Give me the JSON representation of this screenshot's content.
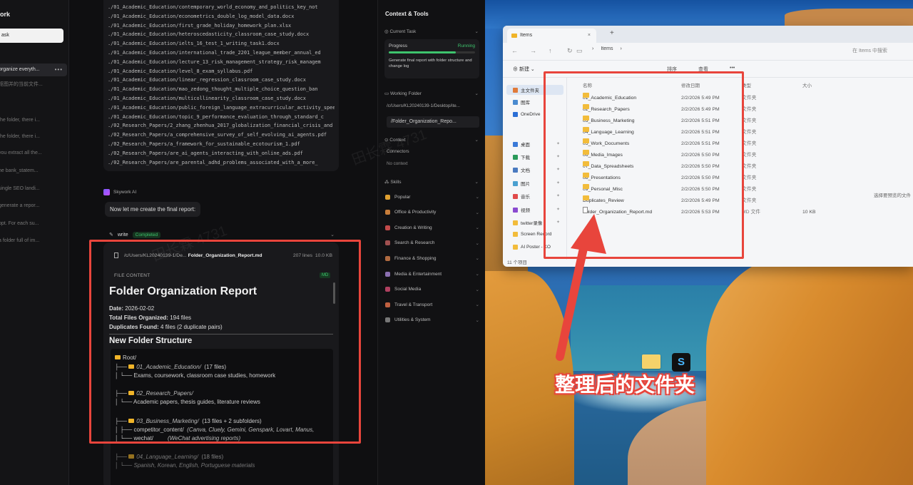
{
  "sidebar": {
    "title": "ork",
    "new_task": "ask",
    "items": [
      {
        "label": "organize everyth...",
        "active": true
      },
      {
        "label": "抠图并的当前文件..."
      },
      {
        "label": "the folder, there i..."
      },
      {
        "label": "the folder, there i..."
      },
      {
        "label": "you extract all the..."
      },
      {
        "label": "he bank_statem..."
      },
      {
        "label": "single SEO landi..."
      },
      {
        "label": "generate a repor..."
      },
      {
        "label": "ppt. For each su..."
      },
      {
        "label": "a folder full of im..."
      }
    ],
    "more": "•••"
  },
  "chat": {
    "file_list": [
      "./01_Academic_Education/contemporary_world_economy_and_politics_key_not",
      "./01_Academic_Education/econometrics_double_log_model_data.docx",
      "./01_Academic_Education/first_grade_holiday_homework_plan.xlsx",
      "./01_Academic_Education/heteroscedasticity_classroom_case_study.docx",
      "./01_Academic_Education/ielts_16_test_1_writing_task1.docx",
      "./01_Academic_Education/international_trade_2201_league_member_annual_ed",
      "./01_Academic_Education/lecture_13_risk_management_strategy_risk_managem",
      "./01_Academic_Education/level_8_exam_syllabus.pdf",
      "./01_Academic_Education/linear_regression_classroom_case_study.docx",
      "./01_Academic_Education/mao_zedong_thought_multiple_choice_question_ban",
      "./01_Academic_Education/multicollinearity_classroom_case_study.docx",
      "./01_Academic_Education/public_foreign_language_extracurricular_activity_spee",
      "./01_Academic_Education/topic_9_performance_evaluation_through_standard_c",
      "./02_Research_Papers/2_zhang_zhenhua_2017_globalization_financial_crisis_and",
      "./02_Research_Papers/a_comprehensive_survey_of_self_evolving_ai_agents.pdf",
      "./02_Research_Papers/a_framework_for_sustainable_ecotourism_1.pdf",
      "./02_Research_Papers/are_ai_agents_interacting_with_online_ads.pdf",
      "./02_Research_Papers/are_parental_adhd_problems_associated_with_a_more_"
    ],
    "agent_name": "Skywork AI",
    "message": "Now let me create the final report:",
    "tool_name": "write",
    "tool_status": "Completed",
    "file": {
      "path": "/c/Users/KL20240139-1/De...",
      "name": "Folder_Organization_Report.md",
      "lines": "207 lines",
      "size": "10.0 KB",
      "section_label": "FILE CONTENT",
      "badge": "MD",
      "title": "Folder Organization Report",
      "date_label": "Date:",
      "date_value": "2026-02-02",
      "total_label": "Total Files Organized:",
      "total_value": "194 files",
      "dup_label": "Duplicates Found:",
      "dup_value": "4 files (2 duplicate pairs)",
      "h2": "New Folder Structure",
      "tree": {
        "root": "Root/",
        "l1": "├── ",
        "l1_name": "01_Academic_Education/",
        "l1_count": "(17 files)",
        "l1_desc": "│   └── Exams, coursework, classroom case studies, homework",
        "l2": "├── ",
        "l2_name": "02_Research_Papers/",
        "l2_desc": "│   └── Academic papers, thesis guides, literature reviews",
        "l3": "├── ",
        "l3_name": "03_Business_Marketing/",
        "l3_count": "(13 files + 2 subfolders)",
        "l3_a": "│   ├── competitor_content/",
        "l3_a_desc": "(Canva, Cluely, Gemini, Genspark, Lovart, Manus,",
        "l3_b": "│   └── wechat/",
        "l3_b_desc": "(WeChat advertising reports)",
        "l4": "├── ",
        "l4_name": "04_Language_Learning/",
        "l4_count": "(18 files)",
        "l4_desc": "│   └── Spanish, Korean, English, Portuguese materials"
      }
    }
  },
  "context": {
    "title": "Context & Tools",
    "current_task": "Current Task",
    "progress_label": "Progress",
    "progress_status": "Running",
    "progress_fraction": 0.78,
    "task_desc": "Generate final report with folder structure and change log",
    "working_folder": "Working Folder",
    "working_path": "/c/Users/KL20240139-1/Desktop/ite...",
    "working_file": "/Folder_Organization_Repo...",
    "context_label": "Context",
    "connectors": "Connectors",
    "no_context": "No context",
    "skills_label": "Skills",
    "skills": [
      {
        "label": "Popular",
        "color": "#e0a030"
      },
      {
        "label": "Office & Productivity",
        "color": "#c77d3a"
      },
      {
        "label": "Creation & Writing",
        "color": "#c24a4a"
      },
      {
        "label": "Search & Research",
        "color": "#a05050"
      },
      {
        "label": "Finance & Shopping",
        "color": "#b06a40"
      },
      {
        "label": "Media & Entertainment",
        "color": "#8a6fb0"
      },
      {
        "label": "Social Media",
        "color": "#b04060"
      },
      {
        "label": "Travel & Transport",
        "color": "#c06040"
      },
      {
        "label": "Utilities & System",
        "color": "#777777"
      }
    ]
  },
  "explorer": {
    "tab_title": "Items",
    "path_items": [
      "Items",
      "›"
    ],
    "search_placeholder": "在 Items 中搜索",
    "new_label": "新建",
    "cmd_sort": "排序",
    "cmd_view": "查看",
    "cmd_more": "•••",
    "nav": [
      {
        "label": "主文件夹",
        "color": "#e07a3a"
      },
      {
        "label": "图库",
        "color": "#4a8ad0"
      },
      {
        "label": "OneDrive",
        "color": "#2b6fd6"
      },
      {
        "label": "桌面",
        "color": "#3a7ad8"
      },
      {
        "label": "下载",
        "color": "#2a9a5a"
      },
      {
        "label": "文档",
        "color": "#4a7ac0"
      },
      {
        "label": "图片",
        "color": "#4aa0d0"
      },
      {
        "label": "音乐",
        "color": "#e04a4a"
      },
      {
        "label": "视频",
        "color": "#8a4ad0"
      },
      {
        "label": "twitter录像",
        "color": "#f2bc3b"
      },
      {
        "label": "Screen Record",
        "color": "#f2bc3b"
      },
      {
        "label": "AI Poster - KO",
        "color": "#f2bc3b"
      }
    ],
    "columns": {
      "name": "名称",
      "date": "修改日期",
      "type": "类型",
      "size": "大小"
    },
    "rows": [
      {
        "name": "01_Academic_Education",
        "date": "2/2/2026 5:49 PM",
        "type": "文件夹",
        "size": "",
        "kind": "folder"
      },
      {
        "name": "02_Research_Papers",
        "date": "2/2/2026 5:49 PM",
        "type": "文件夹",
        "size": "",
        "kind": "folder"
      },
      {
        "name": "03_Business_Marketing",
        "date": "2/2/2026 5:51 PM",
        "type": "文件夹",
        "size": "",
        "kind": "folder"
      },
      {
        "name": "04_Language_Learning",
        "date": "2/2/2026 5:51 PM",
        "type": "文件夹",
        "size": "",
        "kind": "folder"
      },
      {
        "name": "05_Work_Documents",
        "date": "2/2/2026 5:51 PM",
        "type": "文件夹",
        "size": "",
        "kind": "folder"
      },
      {
        "name": "06_Media_Images",
        "date": "2/2/2026 5:50 PM",
        "type": "文件夹",
        "size": "",
        "kind": "folder"
      },
      {
        "name": "07_Data_Spreadsheets",
        "date": "2/2/2026 5:50 PM",
        "type": "文件夹",
        "size": "",
        "kind": "folder"
      },
      {
        "name": "08_Presentations",
        "date": "2/2/2026 5:50 PM",
        "type": "文件夹",
        "size": "",
        "kind": "folder"
      },
      {
        "name": "09_Personal_Misc",
        "date": "2/2/2026 5:50 PM",
        "type": "文件夹",
        "size": "",
        "kind": "folder"
      },
      {
        "name": "Duplicates_Review",
        "date": "2/2/2026 5:49 PM",
        "type": "文件夹",
        "size": "",
        "kind": "folder"
      },
      {
        "name": "Folder_Organization_Report.md",
        "date": "2/2/2026 5:53 PM",
        "type": "MD 文件",
        "size": "10 KB",
        "kind": "file"
      }
    ],
    "status": "11 个项目",
    "preview_hint": "选择要预览的文件"
  },
  "annotation": {
    "caption": "整理后的文件夹",
    "color": "#e8453c"
  },
  "watermark": "田长霖 4731"
}
